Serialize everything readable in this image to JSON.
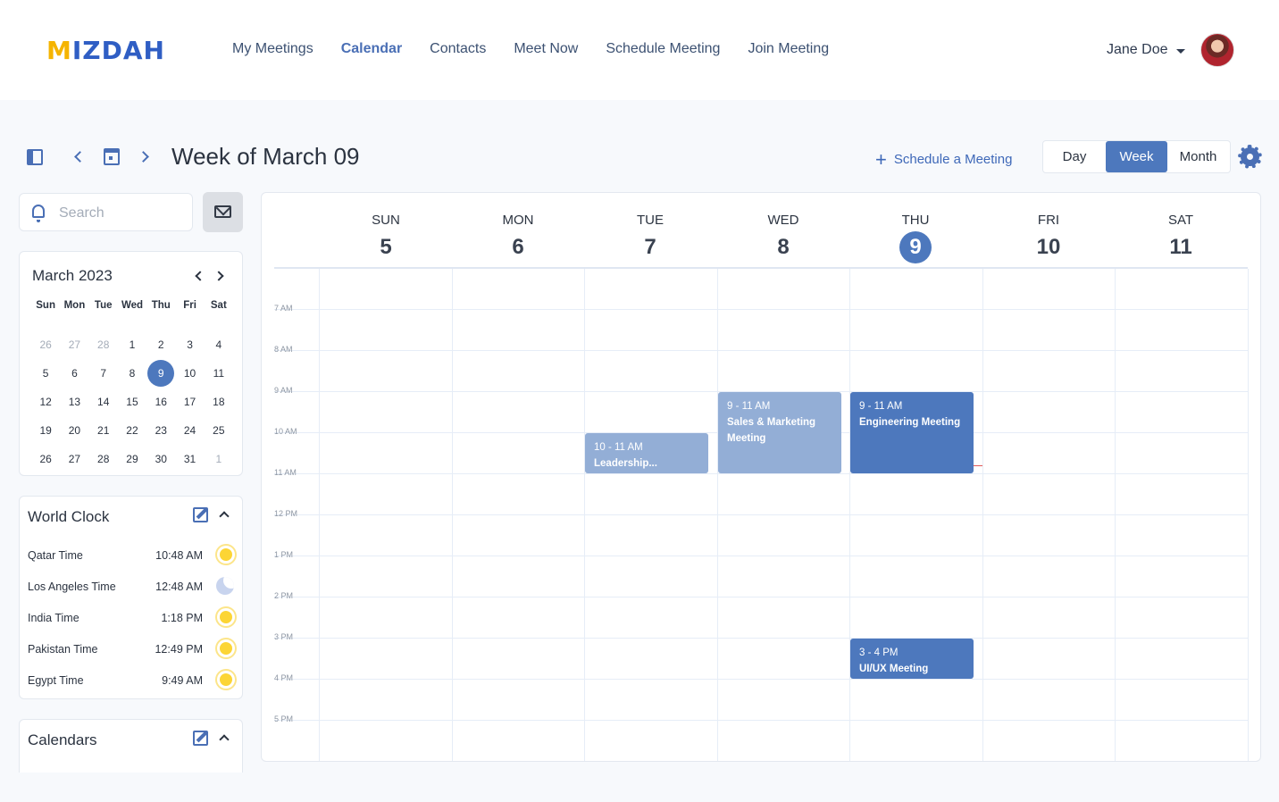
{
  "header": {
    "logo": "MIZDAH",
    "nav": [
      "My Meetings",
      "Calendar",
      "Contacts",
      "Meet Now",
      "Schedule Meeting",
      "Join Meeting"
    ],
    "active_nav": "Calendar",
    "user_name": "Jane Doe"
  },
  "toolbar": {
    "title": "Week of March 09",
    "schedule_label": "Schedule a Meeting",
    "views": [
      "Day",
      "Week",
      "Month"
    ],
    "active_view": "Week"
  },
  "search": {
    "placeholder": "Search"
  },
  "mini_calendar": {
    "title": "March 2023",
    "weekdays": [
      "Sun",
      "Mon",
      "Tue",
      "Wed",
      "Thu",
      "Fri",
      "Sat"
    ],
    "weeks": [
      [
        "26",
        "27",
        "28",
        "1",
        "2",
        "3",
        "4"
      ],
      [
        "5",
        "6",
        "7",
        "8",
        "9",
        "10",
        "11"
      ],
      [
        "12",
        "13",
        "14",
        "15",
        "16",
        "17",
        "18"
      ],
      [
        "19",
        "20",
        "21",
        "22",
        "23",
        "24",
        "25"
      ],
      [
        "26",
        "27",
        "28",
        "29",
        "30",
        "31",
        "1"
      ]
    ],
    "today": "9"
  },
  "world_clock": {
    "title": "World Clock",
    "rows": [
      {
        "name": "Qatar Time",
        "time": "10:48 AM",
        "icon": "sun-icon"
      },
      {
        "name": "Los Angeles Time",
        "time": "12:48 AM",
        "icon": "moon-icon"
      },
      {
        "name": "India Time",
        "time": "1:18 PM",
        "icon": "sun-icon"
      },
      {
        "name": "Pakistan Time",
        "time": "12:49 PM",
        "icon": "sun-icon"
      },
      {
        "name": "Egypt Time",
        "time": "9:49 AM",
        "icon": "sun-icon"
      }
    ]
  },
  "calendars": {
    "title": "Calendars"
  },
  "week": {
    "days": [
      {
        "dow": "SUN",
        "num": "5"
      },
      {
        "dow": "MON",
        "num": "6"
      },
      {
        "dow": "TUE",
        "num": "7"
      },
      {
        "dow": "WED",
        "num": "8"
      },
      {
        "dow": "THU",
        "num": "9"
      },
      {
        "dow": "FRI",
        "num": "10"
      },
      {
        "dow": "SAT",
        "num": "11"
      }
    ],
    "today_index": 4,
    "hours": [
      "7 AM",
      "8 AM",
      "9 AM",
      "10 AM",
      "11 AM",
      "12 PM",
      "1 PM",
      "2 PM",
      "3 PM",
      "4 PM",
      "5 PM"
    ],
    "events": [
      {
        "day": 2,
        "start": 10,
        "end": 11,
        "time": "10 - 11 AM",
        "name": "Leadership...",
        "style": "light"
      },
      {
        "day": 3,
        "start": 9,
        "end": 11,
        "time": "9 - 11 AM",
        "name": "Sales & Marketing Meeting",
        "style": "light"
      },
      {
        "day": 4,
        "start": 9,
        "end": 11,
        "time": "9 - 11 AM",
        "name": "Engineering Meeting",
        "style": "dark"
      },
      {
        "day": 4,
        "start": 15,
        "end": 16,
        "time": "3 - 4 PM",
        "name": "UI/UX Meeting",
        "style": "dark"
      }
    ]
  },
  "colors": {
    "accent": "#4d78bd",
    "event_light": "#93aed6",
    "logo_yellow": "#f5b400"
  }
}
